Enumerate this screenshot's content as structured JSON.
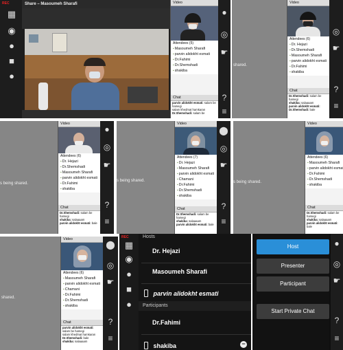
{
  "rec_label": "REC",
  "s1": {
    "share_title": "Share – Masoumeh Sharafi",
    "video_label": "Video",
    "attendees_label": "Attendees (5)",
    "attendees": [
      "Masoumeh Sharafi",
      "parvin alidokht esmati",
      "Dr.Fahimi",
      "Dr.Shemshadi",
      "shakiba"
    ],
    "chat_label": "Chat",
    "chat": [
      {
        "who": "parvin alidokht esmati:",
        "text": "salam be hamegi"
      },
      {
        "who": "",
        "text": "salam khedmat hamkaran"
      },
      {
        "who": "Dr.Shemshadi:",
        "text": "salam be"
      }
    ]
  },
  "s2": {
    "video_label": "Video",
    "attendees_label": "Attendees (6)",
    "attendees": [
      "Dr. Hejazi",
      "Dr.Shemshadi",
      "Masoumeh Sharafi",
      "parvin alidokht esmati",
      "Dr.Fahimi",
      "shakiba"
    ],
    "shared_text": "shared.",
    "chat_label": "Chat",
    "chat": [
      {
        "who": "Dr.Shemshadi:",
        "text": "salam be hamegi"
      },
      {
        "who": "shakiba:",
        "text": "salaaaam"
      },
      {
        "who": "parvin alidokht esmati:",
        "text": ""
      },
      {
        "who": "Dr.Shemshadi:",
        "text": "bale"
      }
    ]
  },
  "s3": {
    "video_label": "Video",
    "attendees_label": "Attendees (6)",
    "attendees": [
      "Dr. Hejazi",
      "Dr.Shemshadi",
      "Masoumeh Sharafi",
      "parvin alidokht esmati",
      "Dr.Fahimi",
      "shakiba"
    ],
    "shared_text": "s being shared.",
    "chat_label": "Chat",
    "chat": [
      {
        "who": "Dr.Shemshadi:",
        "text": "salam be hamegi"
      },
      {
        "who": "shakiba:",
        "text": "salaaaam"
      },
      {
        "who": "parvin alidokht esmati:",
        "text": "bale"
      }
    ]
  },
  "s4": {
    "video_label": "Video",
    "attendees_label": "Attendees (7)",
    "attendees": [
      "Dr. Hejazi",
      "Masoumeh Sharafi",
      "parvin alidokht esmati",
      "Chamani",
      "Dr.Fahimi",
      "Dr.Shemshadi",
      "shakiba"
    ],
    "shared_text": "s being shared.",
    "chat_label": "Chat",
    "chat": [
      {
        "who": "Dr.Shemshadi:",
        "text": "salam be hamegi"
      },
      {
        "who": "shakiba:",
        "text": "salaaaam"
      },
      {
        "who": "parvin alidokht esmati:",
        "text": "bale"
      }
    ]
  },
  "s5": {
    "video_label": "Video",
    "attendees_label": "Attendees (6)",
    "attendees": [
      "Masoumeh Sharafi",
      "parvin alidokht esmati",
      "Dr.Fahimi",
      "Dr.Shemshadi",
      "shakiba"
    ],
    "shared_text": "s being shared.",
    "chat_label": "Chat",
    "chat": [
      {
        "who": "Dr.Shemshadi:",
        "text": "salam be hamegi"
      },
      {
        "who": "shakiba:",
        "text": "salaaaam"
      },
      {
        "who": "parvin alidokht esmati:",
        "text": "bale"
      }
    ]
  },
  "s6": {
    "video_label": "Video",
    "attendees_label": "Attendees (6)",
    "attendees": [
      "Masoumeh Sharafi",
      "parvin alidokht esmati",
      "Chamani",
      "Dr.Fahimi",
      "Dr.Shemshadi",
      "shakiba"
    ],
    "shared_text": "shared.",
    "chat_label": "Chat",
    "chat": [
      {
        "who": "parvin alidokht esmati:",
        "text": "salam be hamegi"
      },
      {
        "who": "",
        "text": "salam khedmat hamkaran"
      },
      {
        "who": "Dr.Shemshadi:",
        "text": "bale"
      },
      {
        "who": "shakiba:",
        "text": "salaaaam"
      }
    ]
  },
  "s7": {
    "hosts_label": "Hosts",
    "hosts": [
      "Dr. Hejazi",
      "Masoumeh Sharafi"
    ],
    "presenter": "parvin alidokht esmati",
    "participants_label": "Participants",
    "participants": [
      "Dr.Fahimi",
      "shakiba"
    ]
  },
  "s8": {
    "host_btn": "Host",
    "presenter_btn": "Presenter",
    "participant_btn": "Participant",
    "private_chat_btn": "Start Private Chat"
  },
  "colors": {
    "active_blue": "#2a8fd8",
    "dark": "#1d1d1d",
    "panel_gray": "#868686"
  }
}
